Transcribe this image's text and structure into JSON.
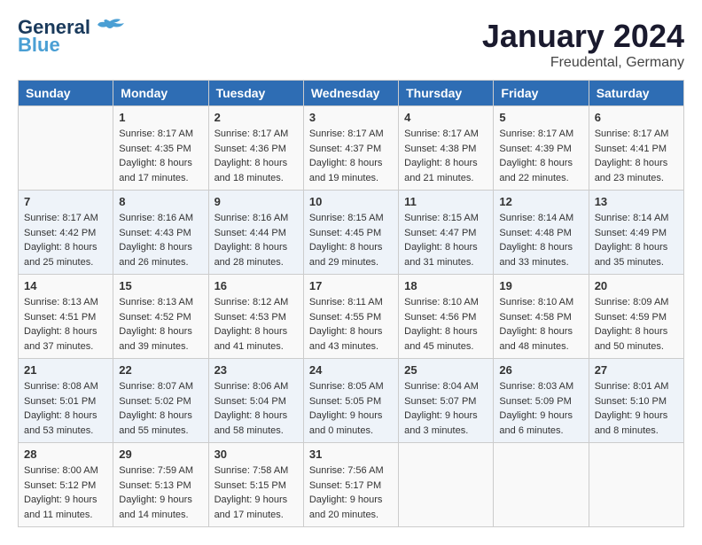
{
  "logo": {
    "text_general": "General",
    "text_blue": "Blue"
  },
  "title": "January 2024",
  "subtitle": "Freudental, Germany",
  "headers": [
    "Sunday",
    "Monday",
    "Tuesday",
    "Wednesday",
    "Thursday",
    "Friday",
    "Saturday"
  ],
  "weeks": [
    [
      {
        "day": "",
        "content": ""
      },
      {
        "day": "1",
        "content": "Sunrise: 8:17 AM\nSunset: 4:35 PM\nDaylight: 8 hours\nand 17 minutes."
      },
      {
        "day": "2",
        "content": "Sunrise: 8:17 AM\nSunset: 4:36 PM\nDaylight: 8 hours\nand 18 minutes."
      },
      {
        "day": "3",
        "content": "Sunrise: 8:17 AM\nSunset: 4:37 PM\nDaylight: 8 hours\nand 19 minutes."
      },
      {
        "day": "4",
        "content": "Sunrise: 8:17 AM\nSunset: 4:38 PM\nDaylight: 8 hours\nand 21 minutes."
      },
      {
        "day": "5",
        "content": "Sunrise: 8:17 AM\nSunset: 4:39 PM\nDaylight: 8 hours\nand 22 minutes."
      },
      {
        "day": "6",
        "content": "Sunrise: 8:17 AM\nSunset: 4:41 PM\nDaylight: 8 hours\nand 23 minutes."
      }
    ],
    [
      {
        "day": "7",
        "content": "Sunrise: 8:17 AM\nSunset: 4:42 PM\nDaylight: 8 hours\nand 25 minutes."
      },
      {
        "day": "8",
        "content": "Sunrise: 8:16 AM\nSunset: 4:43 PM\nDaylight: 8 hours\nand 26 minutes."
      },
      {
        "day": "9",
        "content": "Sunrise: 8:16 AM\nSunset: 4:44 PM\nDaylight: 8 hours\nand 28 minutes."
      },
      {
        "day": "10",
        "content": "Sunrise: 8:15 AM\nSunset: 4:45 PM\nDaylight: 8 hours\nand 29 minutes."
      },
      {
        "day": "11",
        "content": "Sunrise: 8:15 AM\nSunset: 4:47 PM\nDaylight: 8 hours\nand 31 minutes."
      },
      {
        "day": "12",
        "content": "Sunrise: 8:14 AM\nSunset: 4:48 PM\nDaylight: 8 hours\nand 33 minutes."
      },
      {
        "day": "13",
        "content": "Sunrise: 8:14 AM\nSunset: 4:49 PM\nDaylight: 8 hours\nand 35 minutes."
      }
    ],
    [
      {
        "day": "14",
        "content": "Sunrise: 8:13 AM\nSunset: 4:51 PM\nDaylight: 8 hours\nand 37 minutes."
      },
      {
        "day": "15",
        "content": "Sunrise: 8:13 AM\nSunset: 4:52 PM\nDaylight: 8 hours\nand 39 minutes."
      },
      {
        "day": "16",
        "content": "Sunrise: 8:12 AM\nSunset: 4:53 PM\nDaylight: 8 hours\nand 41 minutes."
      },
      {
        "day": "17",
        "content": "Sunrise: 8:11 AM\nSunset: 4:55 PM\nDaylight: 8 hours\nand 43 minutes."
      },
      {
        "day": "18",
        "content": "Sunrise: 8:10 AM\nSunset: 4:56 PM\nDaylight: 8 hours\nand 45 minutes."
      },
      {
        "day": "19",
        "content": "Sunrise: 8:10 AM\nSunset: 4:58 PM\nDaylight: 8 hours\nand 48 minutes."
      },
      {
        "day": "20",
        "content": "Sunrise: 8:09 AM\nSunset: 4:59 PM\nDaylight: 8 hours\nand 50 minutes."
      }
    ],
    [
      {
        "day": "21",
        "content": "Sunrise: 8:08 AM\nSunset: 5:01 PM\nDaylight: 8 hours\nand 53 minutes."
      },
      {
        "day": "22",
        "content": "Sunrise: 8:07 AM\nSunset: 5:02 PM\nDaylight: 8 hours\nand 55 minutes."
      },
      {
        "day": "23",
        "content": "Sunrise: 8:06 AM\nSunset: 5:04 PM\nDaylight: 8 hours\nand 58 minutes."
      },
      {
        "day": "24",
        "content": "Sunrise: 8:05 AM\nSunset: 5:05 PM\nDaylight: 9 hours\nand 0 minutes."
      },
      {
        "day": "25",
        "content": "Sunrise: 8:04 AM\nSunset: 5:07 PM\nDaylight: 9 hours\nand 3 minutes."
      },
      {
        "day": "26",
        "content": "Sunrise: 8:03 AM\nSunset: 5:09 PM\nDaylight: 9 hours\nand 6 minutes."
      },
      {
        "day": "27",
        "content": "Sunrise: 8:01 AM\nSunset: 5:10 PM\nDaylight: 9 hours\nand 8 minutes."
      }
    ],
    [
      {
        "day": "28",
        "content": "Sunrise: 8:00 AM\nSunset: 5:12 PM\nDaylight: 9 hours\nand 11 minutes."
      },
      {
        "day": "29",
        "content": "Sunrise: 7:59 AM\nSunset: 5:13 PM\nDaylight: 9 hours\nand 14 minutes."
      },
      {
        "day": "30",
        "content": "Sunrise: 7:58 AM\nSunset: 5:15 PM\nDaylight: 9 hours\nand 17 minutes."
      },
      {
        "day": "31",
        "content": "Sunrise: 7:56 AM\nSunset: 5:17 PM\nDaylight: 9 hours\nand 20 minutes."
      },
      {
        "day": "",
        "content": ""
      },
      {
        "day": "",
        "content": ""
      },
      {
        "day": "",
        "content": ""
      }
    ]
  ]
}
